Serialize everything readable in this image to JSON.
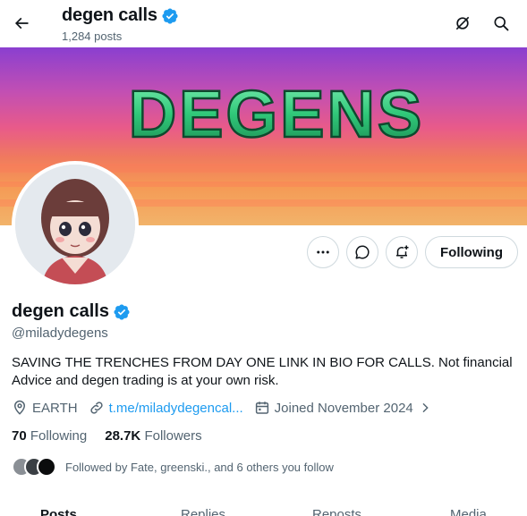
{
  "header": {
    "name": "degen calls",
    "post_count": "1,284 posts"
  },
  "banner": {
    "text": "DEGENS"
  },
  "actions": {
    "following_label": "Following"
  },
  "profile": {
    "name": "degen calls",
    "handle": "@miladydegens",
    "bio": "SAVING THE TRENCHES FROM DAY ONE LINK IN BIO FOR CALLS. Not financial Advice and degen trading is at your own risk.",
    "location": "EARTH",
    "link": "t.me/miladydegencal...",
    "joined": "Joined November 2024",
    "following_count": "70",
    "following_label": "Following",
    "followers_count": "28.7K",
    "followers_label": "Followers",
    "followed_by": "Followed by Fate, greenski., and 6 others you follow"
  },
  "tabs": [
    {
      "label": "Posts"
    },
    {
      "label": "Replies"
    },
    {
      "label": "Reposts"
    },
    {
      "label": "Media"
    }
  ],
  "colors": {
    "accent": "#1d9bf0",
    "verified": "#1d9bf0",
    "banner_text": "#3ed88a"
  },
  "icons": {
    "back": "arrow-left-icon",
    "grok": "grok-icon",
    "search": "search-icon",
    "more": "more-dots-icon",
    "message": "message-icon",
    "notify": "bell-plus-icon",
    "location": "location-pin-icon",
    "link": "link-icon",
    "calendar": "calendar-icon",
    "verified": "verified-badge-icon",
    "chevron": "chevron-right-icon"
  }
}
